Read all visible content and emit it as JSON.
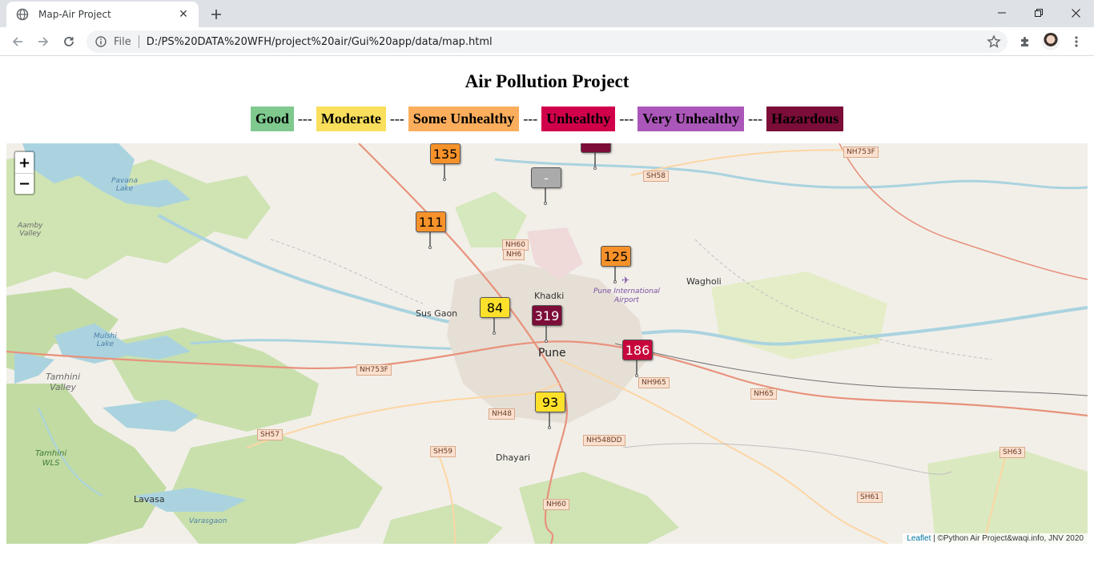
{
  "browser": {
    "tab_title": "Map-Air Project",
    "omnibox_scheme": "File",
    "url": "D:/PS%20DATA%20WFH/project%20air/Gui%20app/data/map.html"
  },
  "page": {
    "title": "Air Pollution Project",
    "legend_separator": "---",
    "legend": [
      {
        "label": "Good",
        "color": "#7fc98f"
      },
      {
        "label": "Moderate",
        "color": "#f9df5b"
      },
      {
        "label": "Some Unhealthy",
        "color": "#fcae5d"
      },
      {
        "label": "Unhealthy",
        "color": "#d1004b"
      },
      {
        "label": "Very Unhealthy",
        "color": "#ab57b9"
      },
      {
        "label": "Hazardous",
        "color": "#7b0d38"
      }
    ]
  },
  "map": {
    "zoom_in": "+",
    "zoom_out": "−",
    "markers": [
      {
        "value": "135",
        "color": "#f7922a",
        "text_color": "#000000"
      },
      {
        "value": "",
        "color": "#7b0d38",
        "text_color": "#ffffff"
      },
      {
        "value": "-",
        "color": "#aaaaaa",
        "text_color": "#ffffff"
      },
      {
        "value": "111",
        "color": "#f7922a",
        "text_color": "#000000"
      },
      {
        "value": "125",
        "color": "#f7922a",
        "text_color": "#000000"
      },
      {
        "value": "84",
        "color": "#fde02a",
        "text_color": "#000000"
      },
      {
        "value": "319",
        "color": "#7b0d38",
        "text_color": "#ffffff"
      },
      {
        "value": "186",
        "color": "#c8063c",
        "text_color": "#ffffff"
      },
      {
        "value": "93",
        "color": "#fde02a",
        "text_color": "#000000"
      }
    ],
    "places": {
      "pune": "Pune",
      "khadki": "Khadki",
      "wagholi": "Wagholi",
      "sus_gaon": "Sus Gaon",
      "dhayari": "Dhayari",
      "lavasa": "Lavasa",
      "tamhini_valley_1": "Tamhini",
      "tamhini_valley_2": "Valley",
      "pavana_1": "Pavana",
      "pavana_2": "Lake",
      "mulshi_1": "Mulshi",
      "mulshi_2": "Lake",
      "aamby_1": "Aamby",
      "aamby_2": "Valley",
      "tamhini_wls_1": "Tamhini",
      "tamhini_wls_2": "WLS",
      "varasgaon": "Varasgaon",
      "airport_1": "Pune International",
      "airport_2": "Airport"
    },
    "shields": {
      "nh753f_top": "NH753F",
      "sh58": "SH58",
      "nh60_a": "NH60",
      "nh6": "NH6",
      "nh753f_left": "NH753F",
      "nh965": "NH965",
      "nh65": "NH65",
      "nh48": "NH48",
      "sh57": "SH57",
      "sh59": "SH59",
      "nh548dd": "NH548DD",
      "nh60_b": "NH60",
      "sh63": "SH63",
      "sh61": "SH61"
    },
    "attribution_link": "Leaflet",
    "attribution_text": " | ©Python Air Project&waqi.info, JNV 2020"
  }
}
